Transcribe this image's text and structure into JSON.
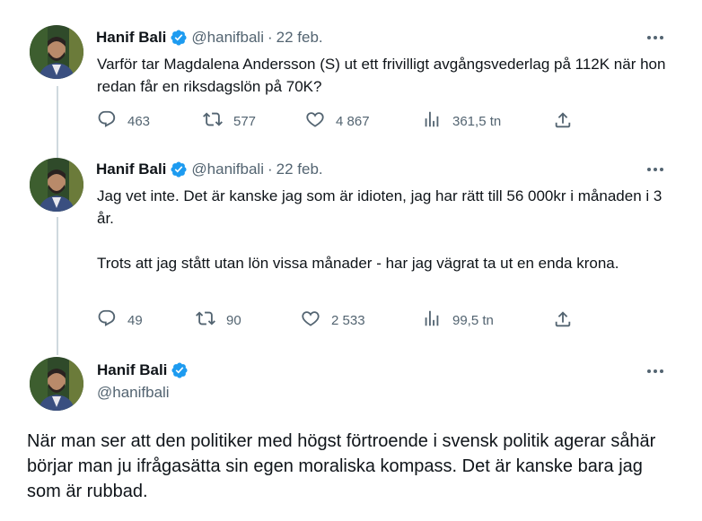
{
  "colors": {
    "verified": "#1d9bf0",
    "text": "#0f1419",
    "muted": "#536471",
    "thread_line": "#cfd9de"
  },
  "tweets": [
    {
      "name": "Hanif Bali",
      "handle": "@hanifbali",
      "separator": "·",
      "date": "22 feb.",
      "text": "Varför tar Magdalena Andersson (S) ut ett frivilligt avgångsvederlag på 112K när hon redan får en riksdagslön på 70K?",
      "replies": "463",
      "retweets": "577",
      "likes": "4 867",
      "views": "361,5 tn"
    },
    {
      "name": "Hanif Bali",
      "handle": "@hanifbali",
      "separator": "·",
      "date": "22 feb.",
      "text": "Jag vet inte. Det är kanske jag som är idioten, jag har rätt till 56 000kr i månaden i 3 år.\n\nTrots att jag stått utan lön vissa månader - har jag vägrat ta ut en enda krona.",
      "replies": "49",
      "retweets": "90",
      "likes": "2 533",
      "views": "99,5 tn"
    }
  ],
  "main_tweet": {
    "name": "Hanif Bali",
    "handle": "@hanifbali",
    "text": "När man ser att den politiker med högst förtroende i svensk politik agerar såhär börjar man ju ifrågasätta sin egen moraliska kompass. Det är kanske bara jag som är rubbad."
  },
  "icons": {
    "more": "more-horizontal-icon",
    "reply": "reply-icon",
    "retweet": "retweet-icon",
    "like": "heart-icon",
    "views": "views-chart-icon",
    "share": "share-icon",
    "verified": "verified-badge-icon"
  }
}
